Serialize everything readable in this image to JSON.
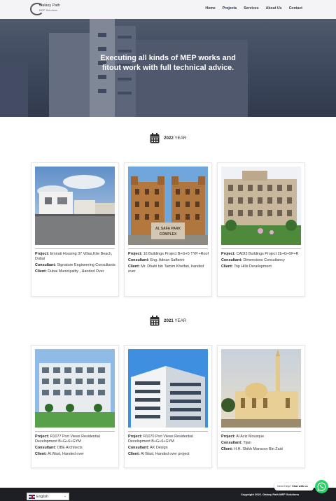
{
  "header": {
    "logo": {
      "name": "Galaxy Path",
      "sub": "MEP Solutions"
    },
    "nav": [
      {
        "label": "Home"
      },
      {
        "label": "Projects"
      },
      {
        "label": "Services"
      },
      {
        "label": "About Us"
      },
      {
        "label": "Contact"
      }
    ]
  },
  "hero": {
    "title": "Executing all kinds of MEP works and fitout work with full technical advice."
  },
  "sections": [
    {
      "year": "2022",
      "suffix": "YEAR",
      "projects": [
        {
          "project_label": "Project:",
          "project": "Emirati Housing 37 Villas,Kite Beach, Dubai",
          "consultant_label": "Consultant:",
          "consultant": "Signature Engineering Consultants",
          "client_label": "Client:",
          "client": "Dubai Municipality , Handed Over"
        },
        {
          "project_label": "Project:",
          "project": "16 Buildings Project B+G+5 TYP.+Roof",
          "consultant_label": "Consultant:",
          "consultant": "Eng. Adnan Saffarini",
          "client_label": "Client:",
          "client": "Mr. Dhahi bin Tamim Khelfan, handed over",
          "sign": "AL SAFA PARK COMPLEX"
        },
        {
          "project_label": "Project:",
          "project": "CADI3 Buildings Project 2b+G+5F+R",
          "consultant_label": "Consultant:",
          "consultant": "Dimensions Consultancy",
          "client_label": "Client:",
          "client": "Top Hills Development"
        }
      ]
    },
    {
      "year": "2021",
      "suffix": "YEAR",
      "projects": [
        {
          "project_label": "Project:",
          "project": "R1077 Port Views Residential Development B+G+6+GYM",
          "consultant_label": "Consultant:",
          "consultant": "OBE Architects",
          "client_label": "Client:",
          "client": "Al Wasl, Handed over"
        },
        {
          "project_label": "Project:",
          "project": "R1070 Port Views Residential Development B+G+6+GYM",
          "consultant_label": "Consultant:",
          "consultant": "AK Design",
          "client_label": "Client:",
          "client": "Al Wasl, Handed over project"
        },
        {
          "project_label": "Project:",
          "project": "Al Aziz Mousque",
          "consultant_label": "Consultant:",
          "consultant": "Tijan",
          "client_label": "Client:",
          "client": "H.H. Shikh Mansoor Bin Zaid"
        }
      ]
    }
  ],
  "footer": {
    "copyright": "Copyright 2022. Galaxy Path MEP Solutions",
    "language": "English",
    "chat_prefix": "Need Help?",
    "chat_cta": "Chat with us"
  },
  "icons": {
    "calendar": "calendar-icon",
    "whatsapp": "whatsapp-icon",
    "flag": "uk-flag-icon"
  },
  "colors": {
    "footer": "#1d1f24",
    "whatsapp": "#25d366",
    "nav_text": "#3a3a3a"
  }
}
